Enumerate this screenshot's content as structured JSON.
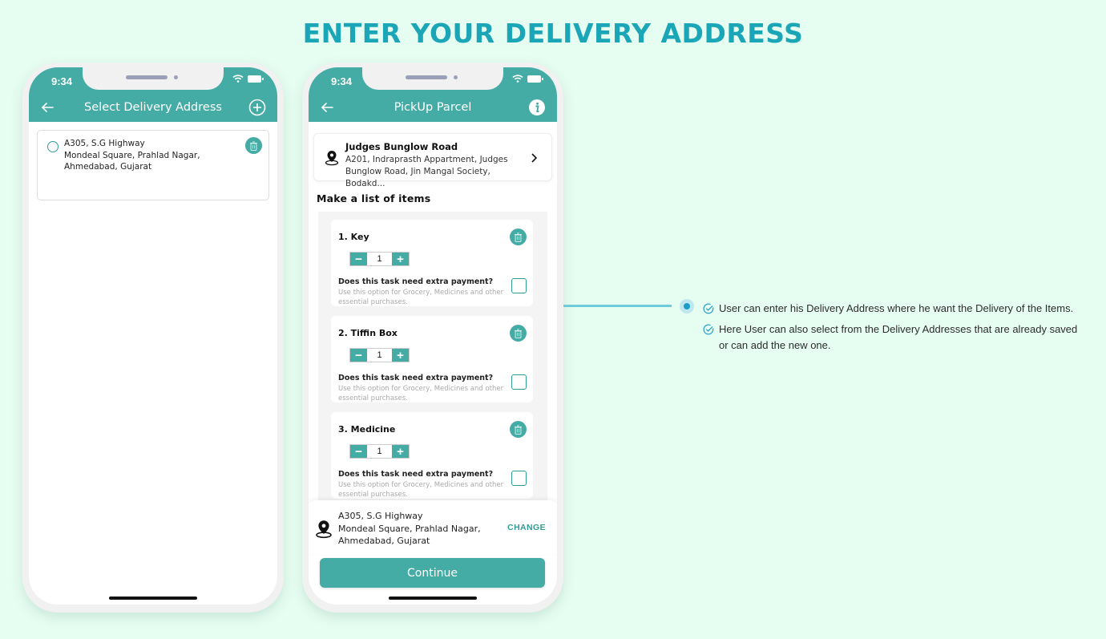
{
  "page": {
    "title": "ENTER YOUR DELIVERY ADDRESS",
    "colors": {
      "accent": "#45aba5",
      "title": "#1aa6b7",
      "background": "#e6fdf1",
      "connector": "#6ecbdc"
    }
  },
  "phone1": {
    "status_time": "9:34",
    "appbar": {
      "title": "Select Delivery Address",
      "left_icon": "back-arrow-icon",
      "right_icon": "add-circle-icon"
    },
    "address_card": {
      "line1": "A305, S.G Highway",
      "line2": "Mondeal Square, Prahlad Nagar,",
      "line3": "Ahmedabad, Gujarat",
      "selected": false
    }
  },
  "phone2": {
    "status_time": "9:34",
    "appbar": {
      "title": "PickUp Parcel",
      "left_icon": "back-arrow-icon",
      "right_icon": "info-icon"
    },
    "pickup": {
      "name": "Judges Bunglow Road",
      "line1": "A201, Indraprasth Appartment, Judges",
      "line2": "Bunglow Road, Jin Mangal Society, Bodakd..."
    },
    "list_title": "Make a list of items",
    "items": [
      {
        "label": "1.  Key",
        "qty": "1",
        "question": "Does this task need extra payment?",
        "hint": "Use this option for Grocery, Medicines and other essential purchases.",
        "checked": false
      },
      {
        "label": "2.  Tiffin Box",
        "qty": "1",
        "question": "Does this task need extra payment?",
        "hint": "Use this option for Grocery, Medicines and other essential purchases.",
        "checked": false
      },
      {
        "label": "3.  Medicine",
        "qty": "1",
        "question": "Does this task need extra payment?",
        "hint": "Use this option for Grocery, Medicines and other essential purchases.",
        "checked": false
      }
    ],
    "stepper": {
      "minus": "−",
      "plus": "+"
    },
    "delivery": {
      "line1": "A305, S.G Highway",
      "line2": "Mondeal Square, Prahlad Nagar,",
      "line3": "Ahmedabad, Gujarat",
      "change_label": "CHANGE"
    },
    "continue_label": "Continue"
  },
  "annotation": {
    "notes": [
      "User can enter his Delivery Address where he want the Delivery of the Items.",
      "Here User can also select from the Delivery Addresses that are already saved or can add the new one."
    ]
  }
}
